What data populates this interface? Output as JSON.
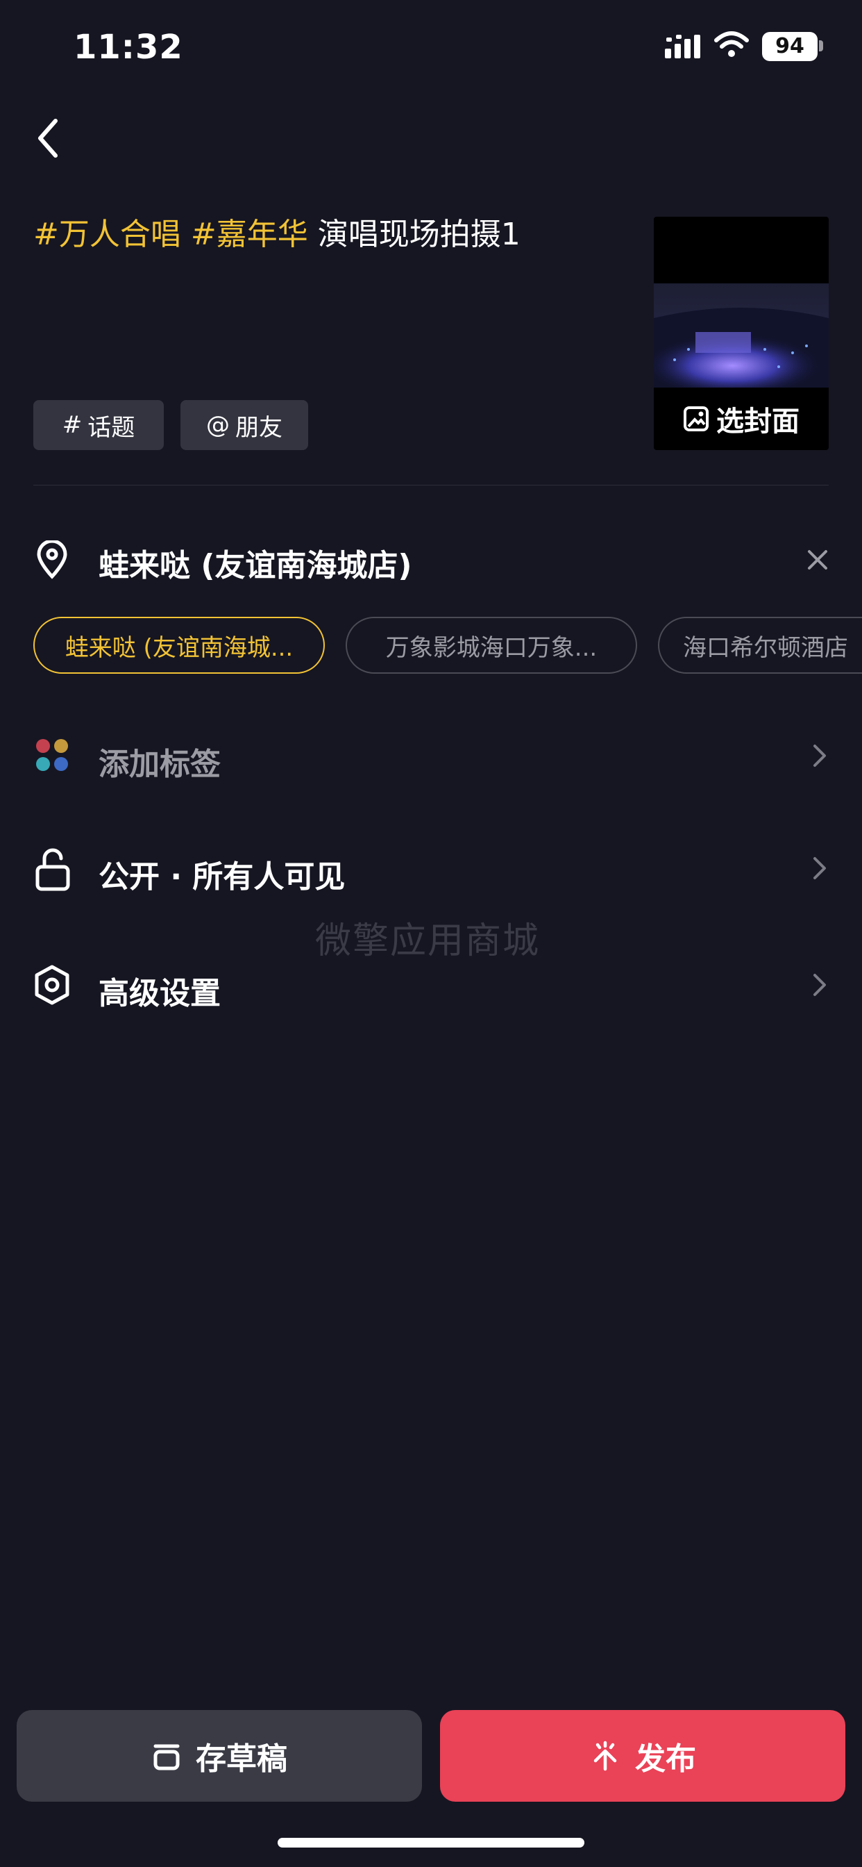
{
  "status_bar": {
    "time": "11:32",
    "battery": "94"
  },
  "caption": {
    "hashtags": [
      "#万人合唱",
      "#嘉年华"
    ],
    "text": "演唱现场拍摄1"
  },
  "chips": {
    "topic": "话题",
    "friend": "朋友",
    "topic_symbol": "#",
    "friend_symbol": "@"
  },
  "cover": {
    "label": "选封面"
  },
  "location": {
    "name": "蛙来哒 (友谊南海城店)",
    "suggestions": [
      "蛙来哒 (友谊南海城...",
      "万象影城海口万象...",
      "海口希尔顿酒店"
    ]
  },
  "settings": {
    "add_tag": "添加标签",
    "privacy": "公开 · 所有人可见",
    "advanced": "高级设置"
  },
  "watermark": "微擎应用商城",
  "actions": {
    "draft": "存草稿",
    "publish": "发布"
  },
  "colors": {
    "accent_yellow": "#f2c335",
    "publish_red": "#ea4257",
    "background": "#161622"
  },
  "icons": [
    "back-icon",
    "location-pin-icon",
    "close-icon",
    "tag-dots-icon",
    "unlock-icon",
    "gear-icon",
    "chevron-right-icon",
    "draft-icon",
    "publish-icon",
    "cover-image-icon"
  ]
}
